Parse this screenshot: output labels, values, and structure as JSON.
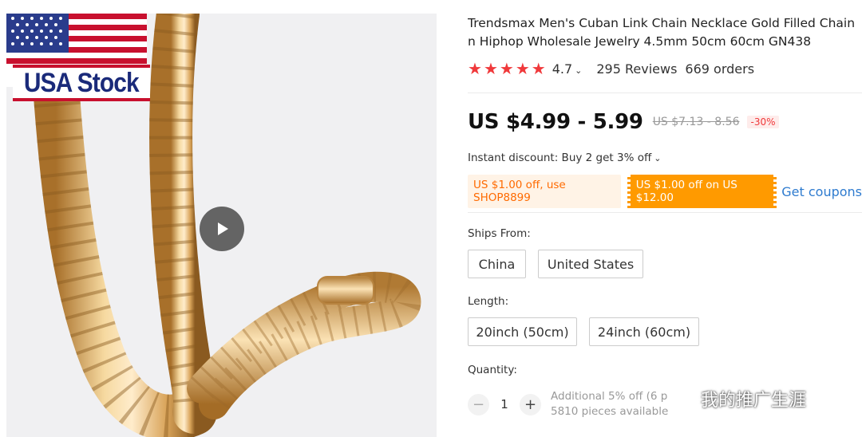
{
  "gallery": {
    "badge_text": "USA Stock"
  },
  "product": {
    "title_line1": "Trendsmax Men's Cuban Link Chain Necklace Gold Filled Chain",
    "title_line2": "n Hiphop Wholesale Jewelry 4.5mm 50cm 60cm GN438",
    "rating": "4.7",
    "rating_out_of": 5,
    "reviews": "295 Reviews",
    "orders": "669 orders",
    "price": "US $4.99 - 5.99",
    "old_price": "US $7.13 - 8.56",
    "discount": "-30%",
    "instant_discount": "Instant discount: Buy 2 get 3% off",
    "coupon_store": "US $1.00 off, use SHOP8899",
    "coupon_select": "US $1.00 off on US $12.00",
    "get_coupons": "Get coupons",
    "ships_from_label": "Ships From:",
    "ships_from_options": [
      "China",
      "United States"
    ],
    "length_label": "Length:",
    "length_options": [
      "20inch (50cm)",
      "24inch (60cm)"
    ],
    "quantity_label": "Quantity:",
    "quantity_value": "1",
    "quantity_minus": "−",
    "quantity_plus": "+",
    "additional_discount": "Additional 5% off (6 p",
    "pieces_available": "5810 pieces available"
  },
  "watermark": {
    "text": "我的推广生涯"
  },
  "colors": {
    "star": "#f0393b",
    "coupon_orange": "#ff9a00",
    "link_blue": "#2e7bcf"
  }
}
